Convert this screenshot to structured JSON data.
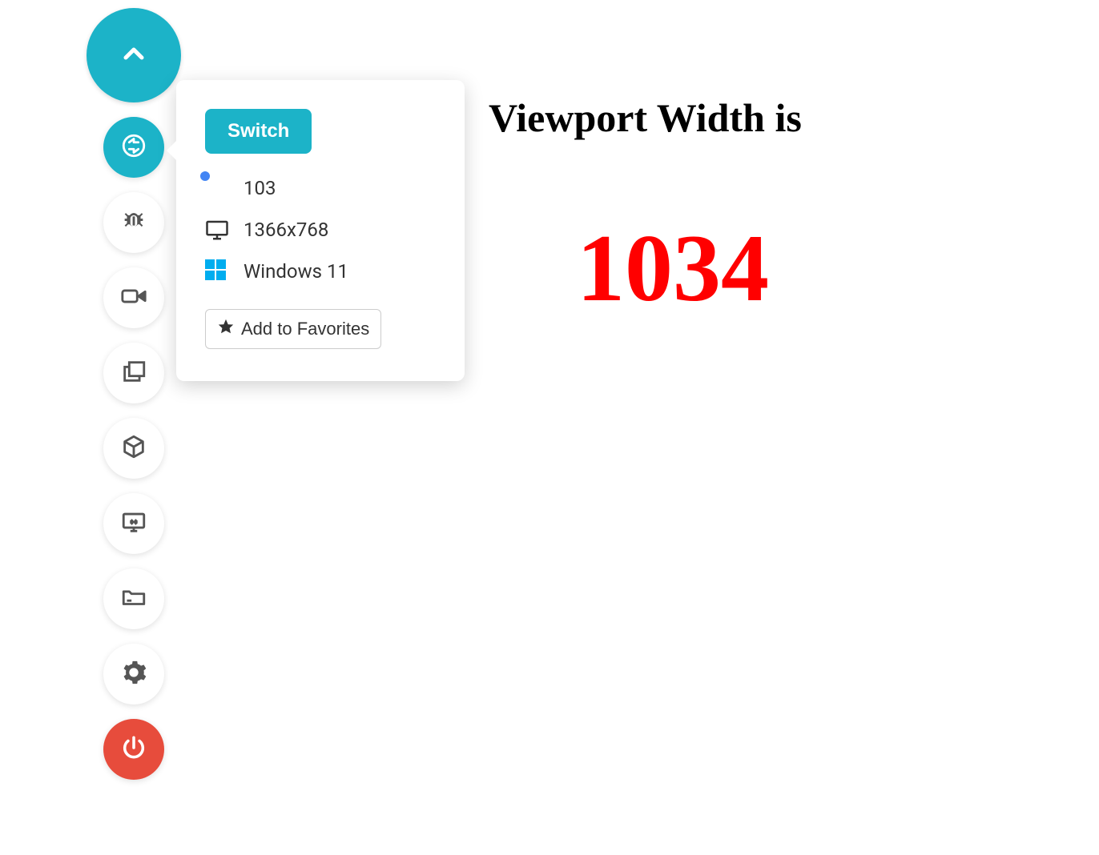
{
  "toolbar": {
    "collapse_icon": "chevron-up",
    "items": [
      {
        "name": "switch",
        "active": true
      },
      {
        "name": "bug"
      },
      {
        "name": "video"
      },
      {
        "name": "screenshots"
      },
      {
        "name": "box"
      },
      {
        "name": "resolution"
      },
      {
        "name": "files"
      },
      {
        "name": "settings"
      },
      {
        "name": "power"
      }
    ]
  },
  "popup": {
    "switch_label": "Switch",
    "browser_version": "103",
    "resolution": "1366x768",
    "os": "Windows 11",
    "favorites_label": "Add to Favorites"
  },
  "page": {
    "heading": "Viewport Width is",
    "value": "1034"
  }
}
